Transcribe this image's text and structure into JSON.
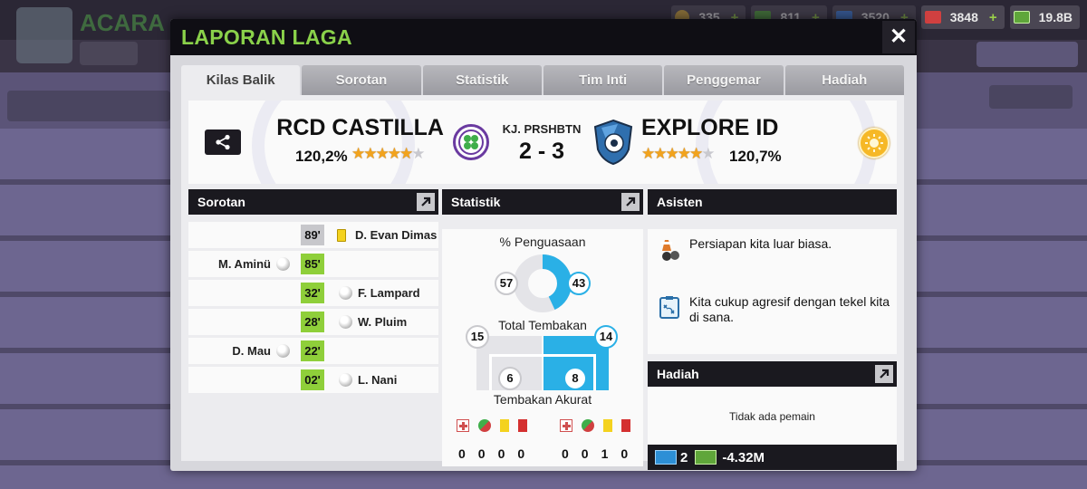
{
  "background": {
    "title": "ACARA",
    "currencies": [
      {
        "value": "335",
        "color": "#c9a23a"
      },
      {
        "value": "811",
        "color": "#4f9a3a"
      },
      {
        "value": "3520",
        "color": "#3c7ad0"
      },
      {
        "value": "3848",
        "color": "#d04040"
      },
      {
        "value": "19.8B",
        "color": "#5fa63a"
      }
    ],
    "plus": "+"
  },
  "modal": {
    "title": "LAPORAN LAGA",
    "close": "✕",
    "tabs": [
      "Kilas Balik",
      "Sorotan",
      "Statistik",
      "Tim Inti",
      "Penggemar",
      "Hadiah"
    ],
    "active_tab": 0
  },
  "match": {
    "home": {
      "name": "RCD CASTILLA",
      "rating": "120,2%",
      "stars_filled": 5,
      "stars_total": 6
    },
    "away": {
      "name": "EXPLORE ID",
      "rating": "120,7%",
      "stars_filled": 5,
      "stars_total": 6
    },
    "score_label": "KJ. PRSHBTN",
    "score": "2 - 3"
  },
  "highlights": {
    "title": "Sorotan",
    "events": [
      {
        "minute": "89'",
        "side": "away",
        "type": "yellow",
        "player": "D. Evan Dimas"
      },
      {
        "minute": "85'",
        "side": "home",
        "type": "goal",
        "player": "M. Aminü"
      },
      {
        "minute": "32'",
        "side": "away",
        "type": "goal",
        "player": "F. Lampard"
      },
      {
        "minute": "28'",
        "side": "away",
        "type": "goal",
        "player": "W. Pluim"
      },
      {
        "minute": "22'",
        "side": "home",
        "type": "goal",
        "player": "D. Mau"
      },
      {
        "minute": "02'",
        "side": "away",
        "type": "goal",
        "player": "L. Nani"
      }
    ]
  },
  "stats": {
    "title": "Statistik",
    "possession_label": "% Penguasaan",
    "possession_home": "57",
    "possession_away": "43",
    "shots_label": "Total Tembakan",
    "shots_home": "15",
    "shots_away": "14",
    "on_target_label": "Tembakan Akurat",
    "on_target_home": "6",
    "on_target_away": "8",
    "home_counts": [
      "0",
      "0",
      "0",
      "0"
    ],
    "away_counts": [
      "0",
      "0",
      "1",
      "0"
    ]
  },
  "assistant": {
    "title": "Asisten",
    "messages": [
      "Persiapan kita luar biasa.",
      "Kita cukup agresif dengan tekel kita di sana."
    ]
  },
  "reward": {
    "title": "Hadiah",
    "empty_text": "Tidak ada pemain",
    "energy": "2",
    "cash": "-4.32M"
  },
  "colors": {
    "accent_green": "#8ad14a",
    "possession_blue": "#2ab0e6",
    "minute_green": "#8fcf3a"
  }
}
